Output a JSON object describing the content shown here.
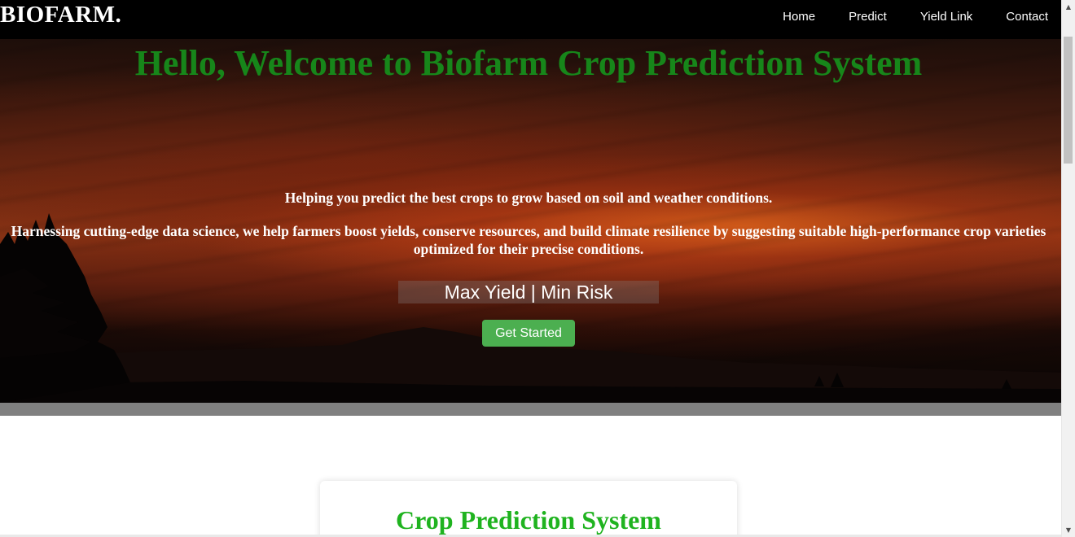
{
  "nav": {
    "brand": "BIOFARM.",
    "links": [
      "Home",
      "Predict",
      "Yield Link",
      "Contact"
    ]
  },
  "hero": {
    "title": "Hello, Welcome to Biofarm Crop Prediction System",
    "subtitle": "Helping you predict the best crops to grow based on soil and weather conditions.",
    "description": "Harnessing cutting-edge data science, we help farmers boost yields, conserve resources, and build climate resilience by suggesting suitable high-performance crop varieties optimized for their precise conditions.",
    "tagline": "Max Yield | Min Risk",
    "cta_label": "Get Started",
    "background_image": "sunset-over-hills"
  },
  "card": {
    "title": "Crop Prediction System"
  },
  "colors": {
    "title_green": "#17861a",
    "card_title_green": "#1fb31f",
    "cta_green": "#4caf50",
    "nav_bg": "#000000"
  }
}
